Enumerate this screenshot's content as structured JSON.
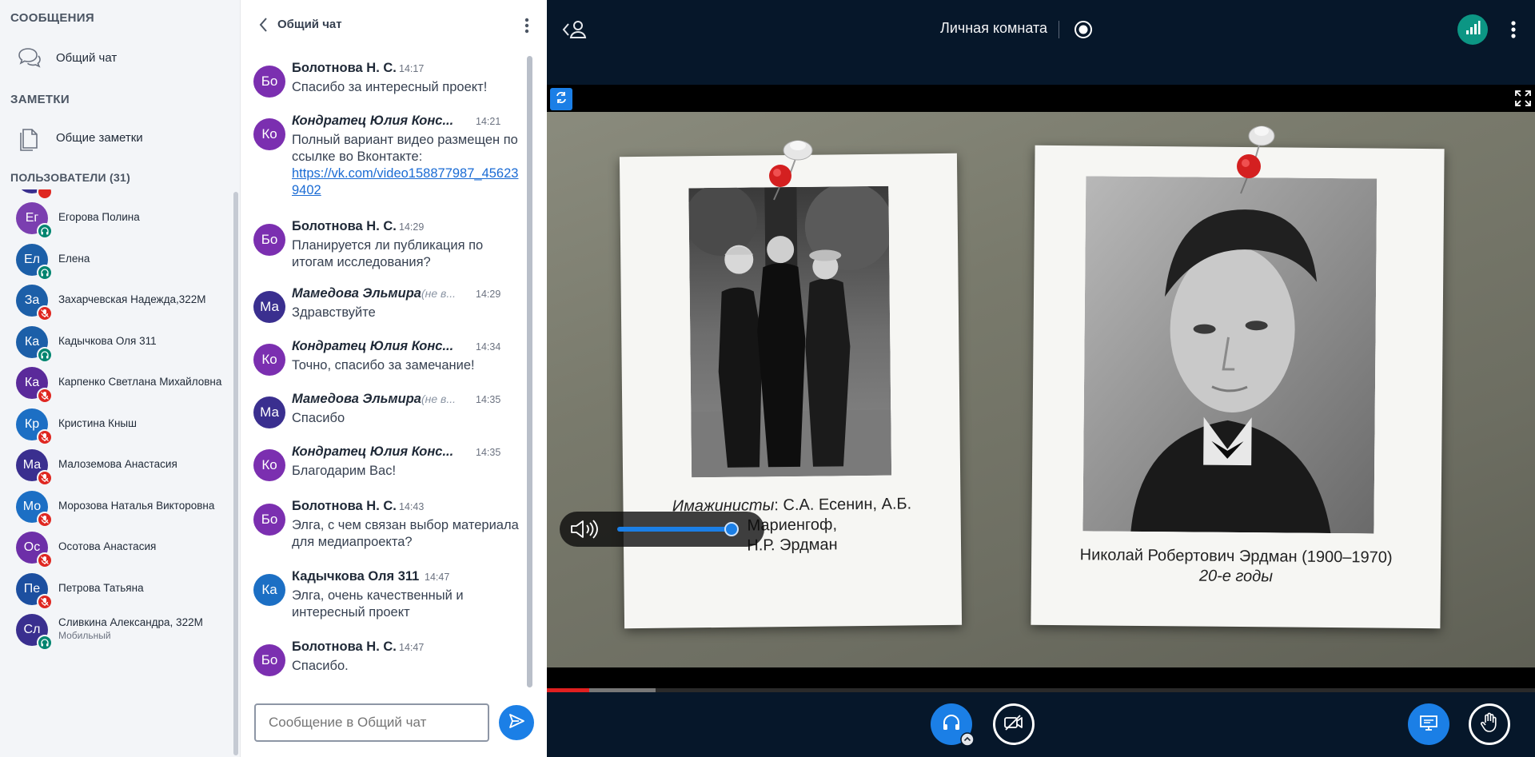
{
  "sidebar": {
    "messages_title": "СООБЩЕНИЯ",
    "public_chat_label": "Общий чат",
    "notes_title": "ЗАМЕТКИ",
    "shared_notes_label": "Общие заметки",
    "users_title": "ПОЛЬЗОВАТЕЛИ (31)",
    "users": [
      {
        "initials": "Ег",
        "name": "Егорова Полина",
        "status": "listen",
        "color": "#7b3fb0"
      },
      {
        "initials": "Ел",
        "name": "Елена",
        "status": "listen",
        "color": "#1c5fa8"
      },
      {
        "initials": "За",
        "name": "Захарчевская Надежда,322М",
        "status": "mic",
        "color": "#1c5fa8"
      },
      {
        "initials": "Ка",
        "name": "Кадычкова Оля 311",
        "status": "listen",
        "color": "#1c5fa8"
      },
      {
        "initials": "Ка",
        "name": "Карпенко Светлана Михайловна",
        "status": "mic",
        "color": "#5a2a9a"
      },
      {
        "initials": "Кр",
        "name": "Кристина Кныш",
        "status": "mic",
        "color": "#1c6fc4"
      },
      {
        "initials": "Ма",
        "name": "Малоземова Анастасия",
        "status": "mic",
        "color": "#3a2f8f"
      },
      {
        "initials": "Мо",
        "name": "Морозова Наталья Викторовна",
        "status": "mic",
        "color": "#1c6fc4"
      },
      {
        "initials": "Ос",
        "name": "Осотова Анастасия",
        "status": "mic",
        "color": "#6d2fa8"
      },
      {
        "initials": "Пе",
        "name": "Петрова Татьяна",
        "status": "mic",
        "color": "#1c4fa0"
      },
      {
        "initials": "Сл",
        "name": "Сливкина Александра, 322М",
        "sub": "Мобильный",
        "status": "listen",
        "color": "#3a2f8f"
      }
    ]
  },
  "chat": {
    "title": "Общий чат",
    "input_placeholder": "Сообщение в Общий чат",
    "messages": [
      {
        "initials": "Бо",
        "name": "Болотнова Н. С.",
        "time": "14:17",
        "text": "Спасибо за интересный проект!",
        "color": "#7b2fb0"
      },
      {
        "initials": "Ко",
        "name": "Кондратец Юлия Конс...",
        "time": "14:21",
        "text": "Полный вариант видео размещен по ссылке во Вконтакте:",
        "link": "https://vk.com/video158877987_456239402",
        "color": "#7b2fb0"
      },
      {
        "initials": "Бо",
        "name": "Болотнова Н. С.",
        "time": "14:29",
        "text": "Планируется ли публикация по итогам исследования?",
        "color": "#7b2fb0"
      },
      {
        "initials": "Ма",
        "name": "Мамедова Эльмира",
        "suffix": "(не в...",
        "time": "14:29",
        "text": "Здравствуйте",
        "color": "#3a2f8f"
      },
      {
        "initials": "Ко",
        "name": "Кондратец Юлия Конс...",
        "time": "14:34",
        "text": "Точно, спасибо за замечание!",
        "color": "#7b2fb0"
      },
      {
        "initials": "Ма",
        "name": "Мамедова Эльмира",
        "suffix": "(не в...",
        "time": "14:35",
        "text": "Спасибо",
        "color": "#3a2f8f"
      },
      {
        "initials": "Ко",
        "name": "Кондратец Юлия Конс...",
        "time": "14:35",
        "text": "Благодарим Вас!",
        "color": "#7b2fb0"
      },
      {
        "initials": "Бо",
        "name": "Болотнова Н. С.",
        "time": "14:43",
        "text": "Элга, с чем связан выбор материала для медиапроекта?",
        "color": "#7b2fb0"
      },
      {
        "initials": "Ка",
        "name": "Кадычкова Оля 311",
        "time": "14:47",
        "text": "Элга, очень качественный и интересный проект",
        "color": "#1c6fc4"
      },
      {
        "initials": "Бо",
        "name": "Болотнова Н. С.",
        "time": "14:47",
        "text": "Спасибо.",
        "color": "#7b2fb0"
      }
    ]
  },
  "main": {
    "room_title": "Личная комната",
    "slide": {
      "caption_left_italic": "Имажинисты",
      "caption_left_rest": ": С.А. Есенин, А.Б. Мариенгоф,",
      "caption_left_line2": "Н.Р. Эрдман",
      "caption_right_line1": "Николай Робертович Эрдман (1900–1970)",
      "caption_right_line2": "20-е годы"
    },
    "volume": 0.95,
    "video_progress": 0.043,
    "video_buffered": 0.11
  },
  "colors": {
    "accent": "#1b7fe6",
    "listen": "#008570",
    "mic": "#df2721",
    "background": "#06172a"
  }
}
